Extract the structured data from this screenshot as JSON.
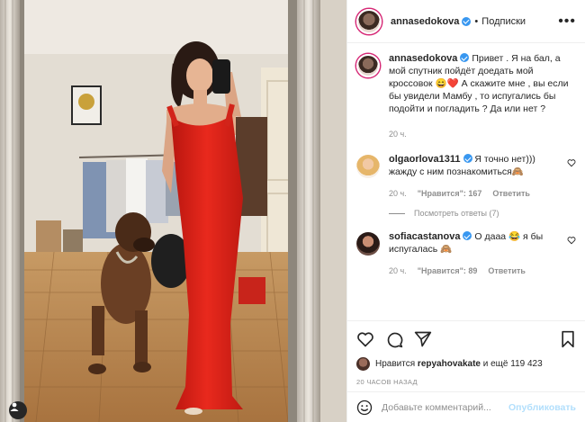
{
  "header": {
    "username": "annasedokova",
    "separator": "•",
    "follow_label": "Подписки",
    "more": "•••"
  },
  "caption": {
    "username": "annasedokova",
    "text": "Привет . Я на бал, а мой спутник пойдёт доедать мой кроссовок 😄❤️ А скажите мне , вы если бы увидели Мамбу , то испугались бы подойти и погладить ? Да или нет ?",
    "time": "20 ч."
  },
  "comments": [
    {
      "username": "olgaorlova1311",
      "text": "Я точно нет))) жажду с ним познакомиться🙈",
      "time": "20 ч.",
      "likes": "\"Нравится\": 167",
      "reply": "Ответить"
    },
    {
      "username": "sofiacastanova",
      "text": "О дааа 😂 я бы испугалась 🙈",
      "time": "20 ч.",
      "likes": "\"Нравится\": 89",
      "reply": "Ответить"
    }
  ],
  "view_replies": "Посмотреть ответы (7)",
  "likes_line": {
    "prefix": "Нравится",
    "user": "rерyahovakate",
    "suffix": "и ещё 119 423"
  },
  "timestamp": "20 ЧАСОВ НАЗАД",
  "comment_input": {
    "placeholder": "Добавьте комментарий..."
  },
  "publish_label": "Опубликовать",
  "icons": [
    "heart-icon",
    "comment-icon",
    "share-icon",
    "bookmark-icon",
    "user-icon",
    "emoji-icon",
    "more-icon"
  ],
  "colors": {
    "verified": "#3897f0",
    "publish_disabled": "#b2dffc",
    "dress": "#e0261c",
    "story_ring": "#d62976"
  }
}
